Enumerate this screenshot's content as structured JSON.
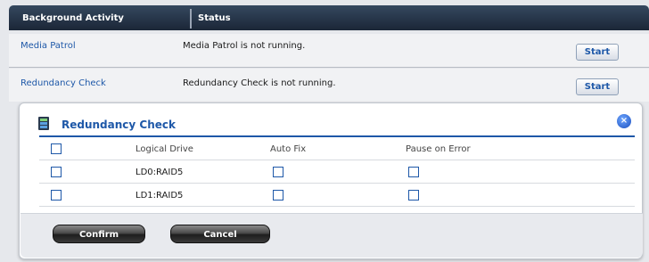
{
  "header": {
    "col1": "Background Activity",
    "col2": "Status"
  },
  "activities": [
    {
      "name": "Media Patrol",
      "status": "Media Patrol is not running.",
      "button": "Start"
    },
    {
      "name": "Redundancy Check",
      "status": "Redundancy Check is not running.",
      "button": "Start"
    }
  ],
  "dialog": {
    "title": "Redundancy Check",
    "close_glyph": "×",
    "columns": {
      "drive": "Logical Drive",
      "autofix": "Auto Fix",
      "pause": "Pause on Error"
    },
    "rows": [
      {
        "drive": "LD0:RAID5"
      },
      {
        "drive": "LD1:RAID5"
      }
    ],
    "confirm": "Confirm",
    "cancel": "Cancel"
  },
  "colors": {
    "accent": "#1e58a8",
    "header_bg": "#1b2637"
  }
}
